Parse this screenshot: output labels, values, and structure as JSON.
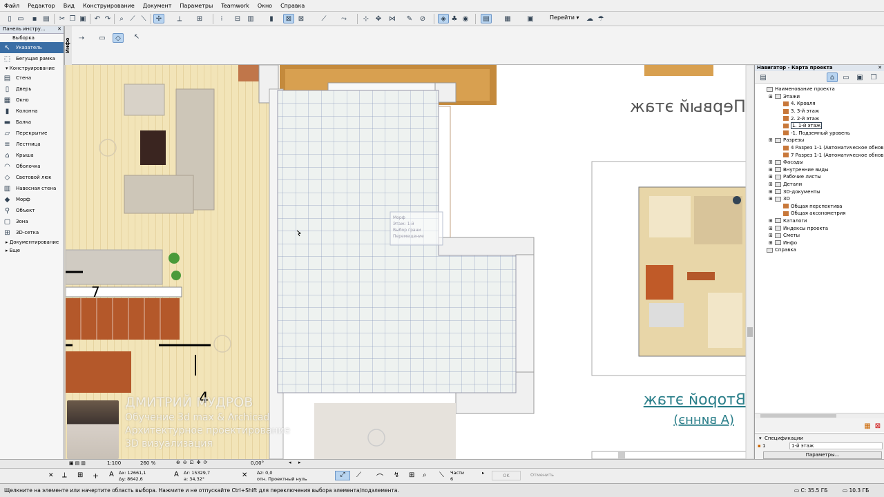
{
  "menu": [
    "Файл",
    "Редактор",
    "Вид",
    "Конструирование",
    "Документ",
    "Параметры",
    "Teamwork",
    "Окно",
    "Справка"
  ],
  "toolbar": {
    "goto_label": "Перейти"
  },
  "info_tab_label": "Инфо",
  "toolbox": {
    "title": "Панель инстру...",
    "selection_header": "Выборка",
    "selection_items": [
      "Указатель",
      "Бегущая рамка"
    ],
    "design_header": "Конструирование",
    "design_items": [
      "Стена",
      "Дверь",
      "Окно",
      "Колонна",
      "Балка",
      "Перекрытие",
      "Лестница",
      "Крыша",
      "Оболочка",
      "Световой люк",
      "Навесная стена",
      "Морф",
      "Объект",
      "Зона",
      "3D-сетка"
    ],
    "doc_header": "Документирование",
    "more_header": "Еще"
  },
  "plan": {
    "tooltip_lines": [
      "Морф",
      "Этаж: 1-й",
      "Выбор грани",
      "Перемещение"
    ],
    "dim_labels": [
      "7",
      "4"
    ],
    "layout_labels": [
      "Первый этаж",
      "Второй этаж",
      "(А виннэ)"
    ]
  },
  "navigator": {
    "title": "Навигатор - Карта проекта",
    "tree": [
      {
        "label": "Наименование проекта",
        "level": 0,
        "icon": "project"
      },
      {
        "label": "Этажи",
        "level": 1,
        "icon": "folder"
      },
      {
        "label": "4. Кровля",
        "level": 2,
        "icon": "story"
      },
      {
        "label": "3. 3-й этаж",
        "level": 2,
        "icon": "story"
      },
      {
        "label": "2. 2-й этаж",
        "level": 2,
        "icon": "story"
      },
      {
        "label": "1. 1-й этаж",
        "level": 2,
        "icon": "story",
        "selected": true
      },
      {
        "label": "-1. Подземный уровень",
        "level": 2,
        "icon": "story"
      },
      {
        "label": "Разрезы",
        "level": 1,
        "icon": "folder"
      },
      {
        "label": "4 Разрез 1-1 (Автоматическое обнов",
        "level": 2,
        "icon": "section"
      },
      {
        "label": "7 Разрез 1-1 (Автоматическое обнов",
        "level": 2,
        "icon": "section"
      },
      {
        "label": "Фасады",
        "level": 1,
        "icon": "folder"
      },
      {
        "label": "Внутренние виды",
        "level": 1,
        "icon": "folder"
      },
      {
        "label": "Рабочие листы",
        "level": 1,
        "icon": "folder"
      },
      {
        "label": "Детали",
        "level": 1,
        "icon": "folder"
      },
      {
        "label": "3D-документы",
        "level": 1,
        "icon": "folder"
      },
      {
        "label": "3D",
        "level": 1,
        "icon": "folder"
      },
      {
        "label": "Общая перспектива",
        "level": 2,
        "icon": "persp"
      },
      {
        "label": "Общая аксонометрия",
        "level": 2,
        "icon": "persp"
      },
      {
        "label": "Каталоги",
        "level": 1,
        "icon": "folder"
      },
      {
        "label": "Индексы проекта",
        "level": 1,
        "icon": "folder"
      },
      {
        "label": "Сметы",
        "level": 1,
        "icon": "folder"
      },
      {
        "label": "Инфо",
        "level": 1,
        "icon": "folder"
      },
      {
        "label": "Справка",
        "level": 0,
        "icon": "help"
      }
    ],
    "specs_label": "Спецификации",
    "spec_value": "1-й этаж",
    "spec_num": "1",
    "params_button": "Параметры..."
  },
  "bottombar": {
    "scale": "1:100",
    "zoom": "260 %",
    "angle": "0,00°"
  },
  "coords": {
    "dx": "Δx: 12661,1",
    "dy": "Δy: 8642,6",
    "r": "Δr: 15329,7",
    "a": "a: 34,32°",
    "dz": "Δz: 0,0",
    "ref": "отн. Проектный нуль",
    "parts": "Части",
    "parts_val": "6",
    "ok": "OK",
    "cancel": "Отменить"
  },
  "status": {
    "message": "Щелкните на элементе или начертите область выбора. Нажмите и не отпускайте Ctrl+Shift для переключения выбора элемента/подэлемента.",
    "disk_c": "C: 35.5 ГБ",
    "mem": "10.3 ГБ"
  },
  "watermark": {
    "name": "ДМИТРИЙ МУДРОВ",
    "line1": "Обучение 3d max & Archicad",
    "line2": "Архитектурное проектирование",
    "line3": "3D визуализация"
  }
}
